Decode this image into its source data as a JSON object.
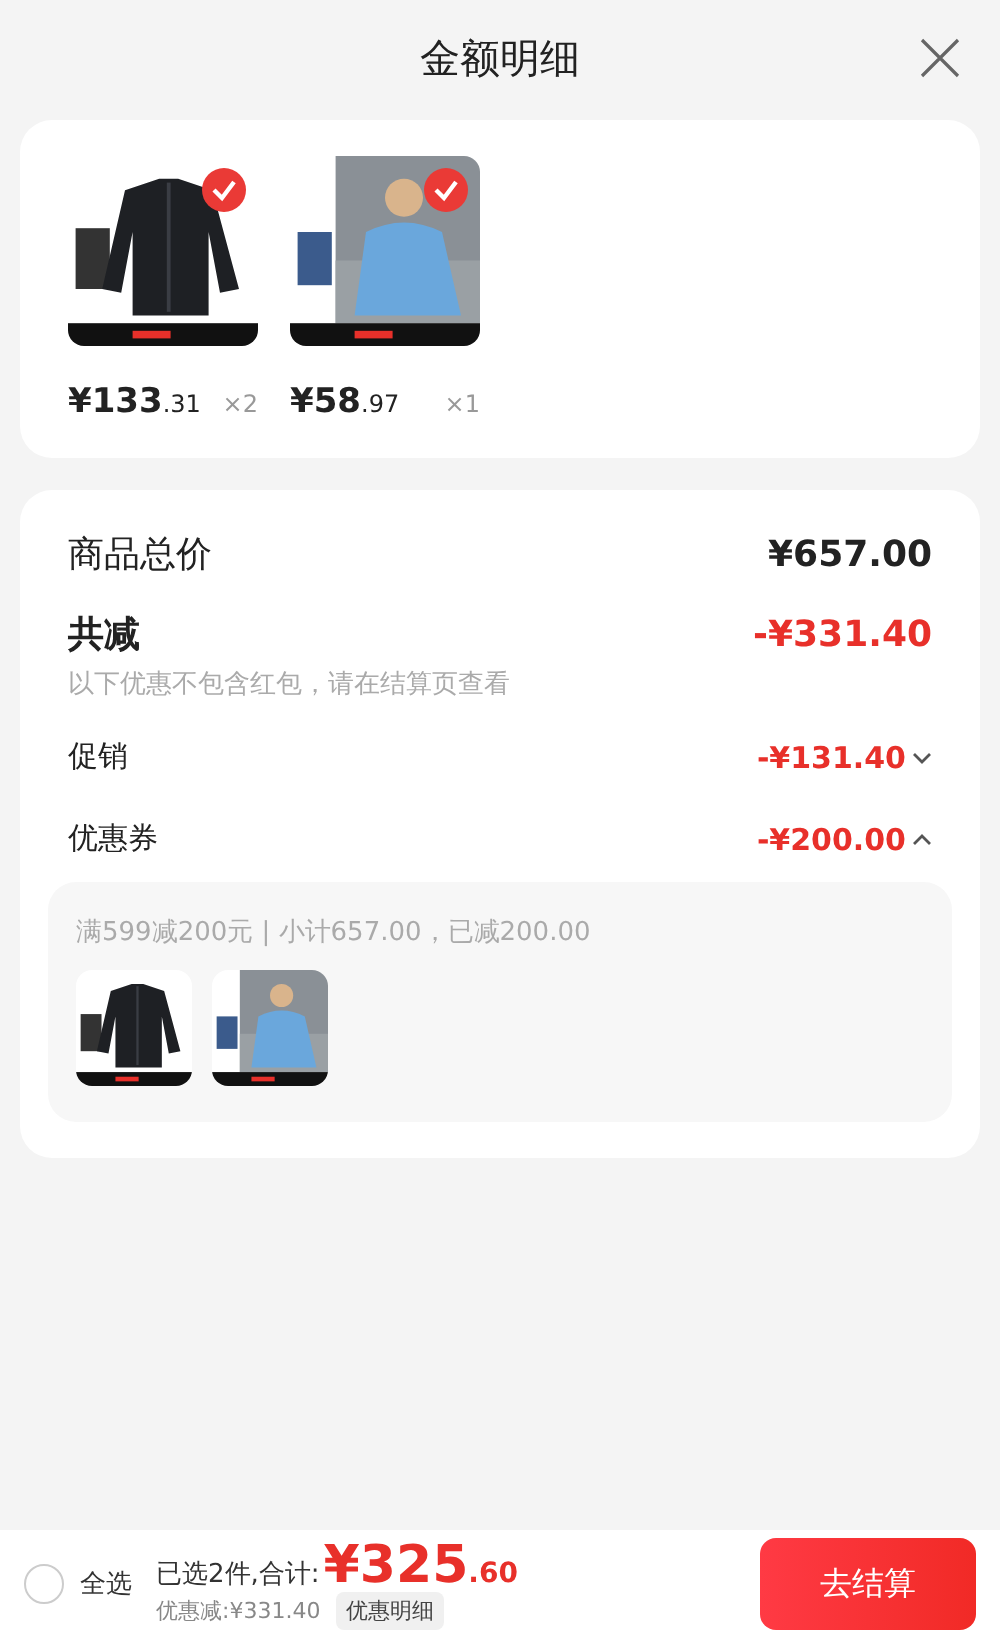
{
  "header": {
    "title": "金额明细"
  },
  "products": [
    {
      "checked": true,
      "price_main": "¥133",
      "price_decimal": ".31",
      "quantity": "×2"
    },
    {
      "checked": true,
      "price_main": "¥58",
      "price_decimal": ".97",
      "quantity": "×1"
    }
  ],
  "summary": {
    "total_label": "商品总价",
    "total_value": "¥657.00",
    "discount_label": "共减",
    "discount_value": "-¥331.40",
    "note": "以下优惠不包含红包，请在结算页查看"
  },
  "discounts": [
    {
      "label": "促销",
      "value": "-¥131.40",
      "expanded": false
    },
    {
      "label": "优惠券",
      "value": "-¥200.00",
      "expanded": true,
      "detail": "满599减200元 | 小计657.00，已减200.00"
    }
  ],
  "footer": {
    "select_all_label": "全选",
    "select_all_checked": false,
    "selected_text": "已选2件,合计:",
    "total_main": "¥325",
    "total_decimal": ".60",
    "saved_text": "优惠减:¥331.40",
    "details_button": "优惠明细",
    "checkout_button": "去结算"
  }
}
